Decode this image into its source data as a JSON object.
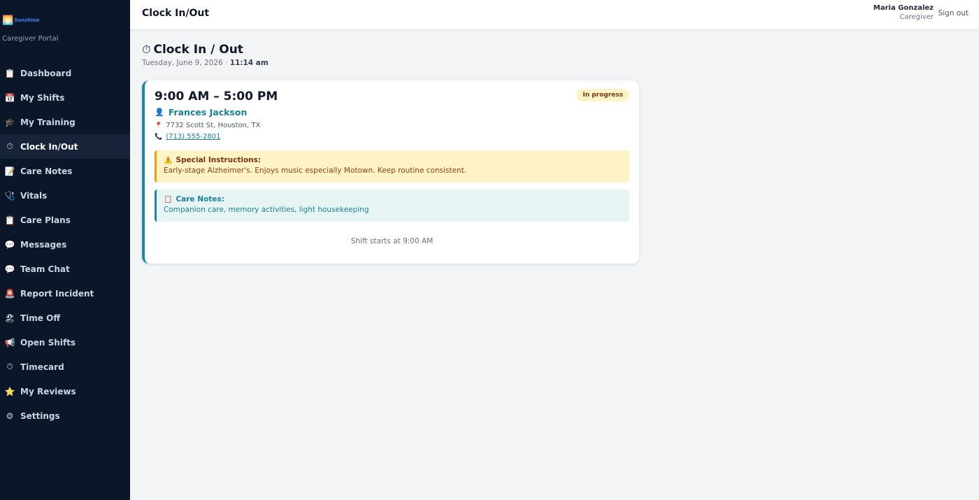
{
  "brand": {
    "logo_text": "Sunshine",
    "portal_label": "Caregiver Portal"
  },
  "sidebar": {
    "items": [
      {
        "label": "Dashboard",
        "icon": "📋"
      },
      {
        "label": "My Shifts",
        "icon": "📅"
      },
      {
        "label": "My Training",
        "icon": "🎓"
      },
      {
        "label": "Clock In/Out",
        "icon": "⏱",
        "active": true
      },
      {
        "label": "Care Notes",
        "icon": "📝"
      },
      {
        "label": "Vitals",
        "icon": "🩺"
      },
      {
        "label": "Care Plans",
        "icon": "📋"
      },
      {
        "label": "Messages",
        "icon": "💬"
      },
      {
        "label": "Team Chat",
        "icon": "💬"
      },
      {
        "label": "Report Incident",
        "icon": "🚨"
      },
      {
        "label": "Time Off",
        "icon": "🏖"
      },
      {
        "label": "Open Shifts",
        "icon": "📢"
      },
      {
        "label": "Timecard",
        "icon": "⏱"
      },
      {
        "label": "My Reviews",
        "icon": "⭐"
      },
      {
        "label": "Settings",
        "icon": "⚙"
      }
    ]
  },
  "topbar": {
    "title": "Clock In/Out",
    "user_name": "Maria Gonzalez",
    "user_role": "Caregiver",
    "signout_label": "Sign out"
  },
  "page": {
    "heading_icon": "⏱",
    "heading": "Clock In / Out",
    "date_prefix": "Tuesday, June 9, 2026 · ",
    "time": "11:14 am"
  },
  "shift": {
    "time_range": "9:00 AM – 5:00 PM",
    "status": "In progress",
    "client_icon": "👤",
    "client_name": "Frances Jackson",
    "address_icon": "📍",
    "address": "7732 Scott St, Houston, TX",
    "phone_icon": "📞",
    "phone": "(713) 555-2801",
    "special_icon": "⚠️",
    "special_title": "Special Instructions:",
    "special_body": "Early-stage Alzheimer's. Enjoys music especially Motown. Keep routine consistent.",
    "notes_icon": "📋",
    "notes_title": "Care Notes:",
    "notes_body": "Companion care, memory activities, light housekeeping",
    "start_message": "Shift starts at 9:00 AM"
  },
  "colors": {
    "sidebar_bg": "#0b1629",
    "accent": "#1b8aa0",
    "badge_bg": "#fef3c7",
    "special_bg": "#fef3c7",
    "notes_bg": "#e6f4f4"
  }
}
